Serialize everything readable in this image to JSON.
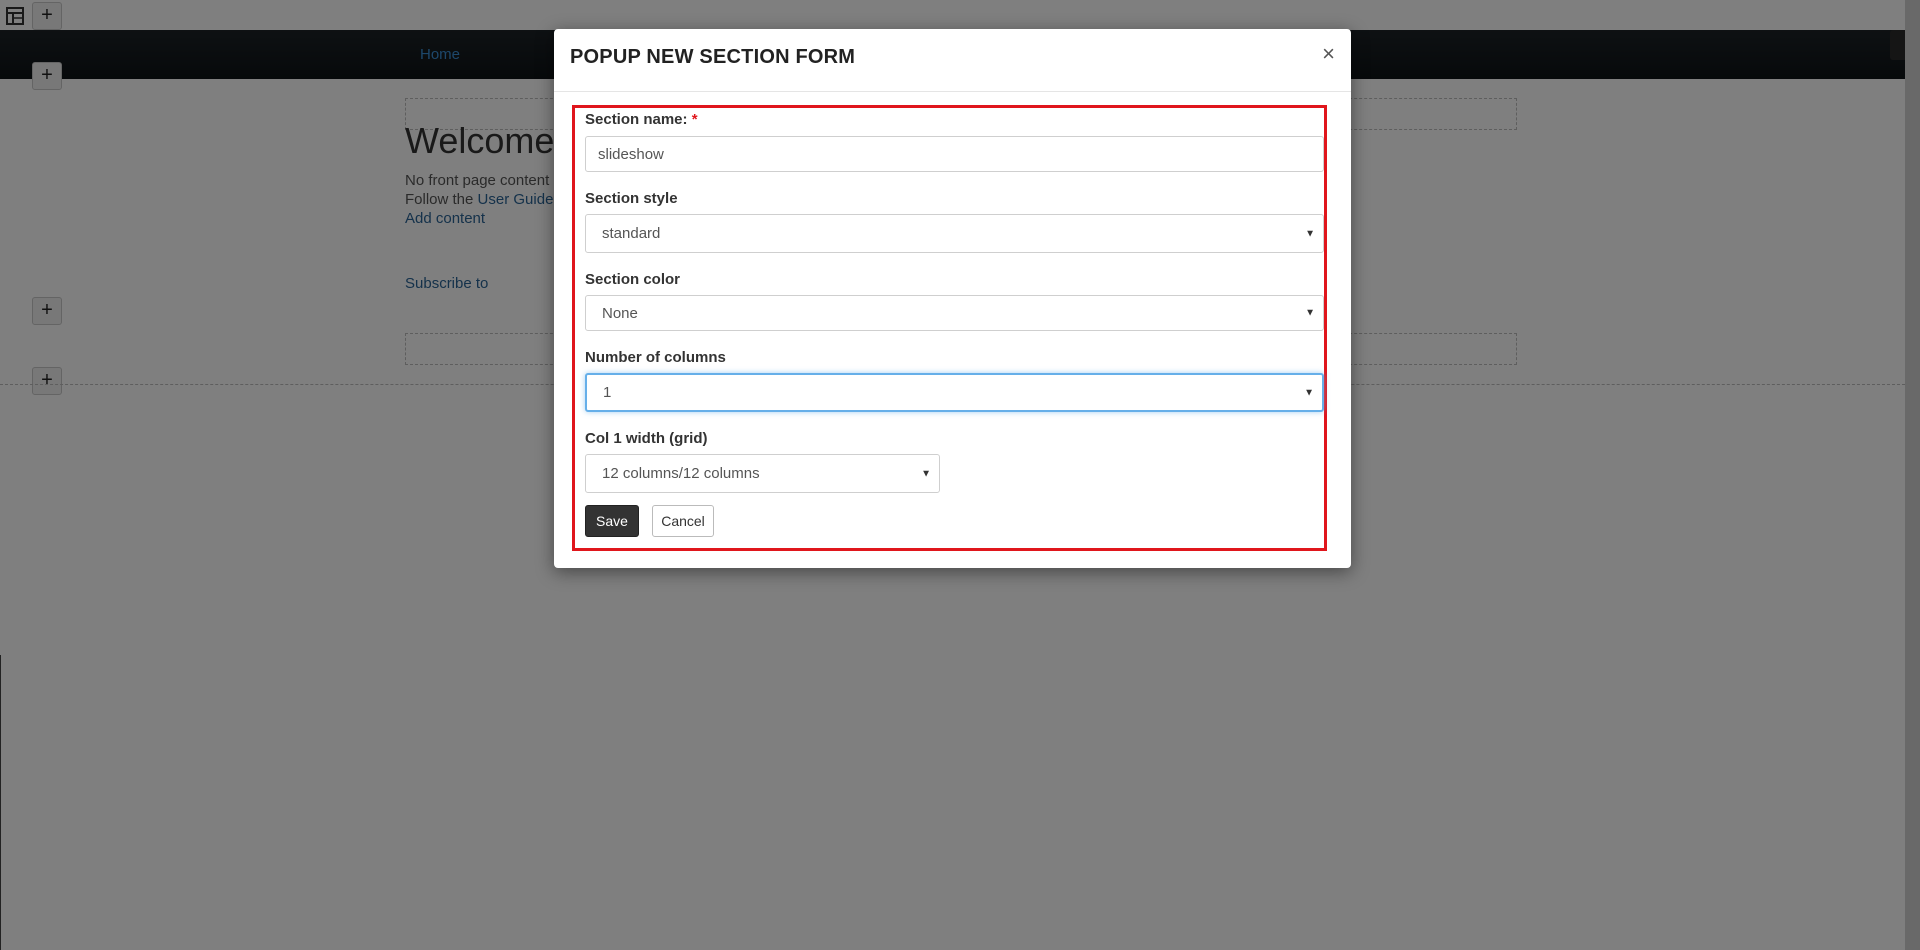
{
  "background": {
    "nav": {
      "home_label": "Home"
    },
    "page": {
      "welcome_title": "Welcome",
      "line1": "No front page content",
      "line2_prefix": "Follow the ",
      "line2_link": "User Guide",
      "add_content": "Add content",
      "subscribe": "Subscribe to"
    },
    "add_section_symbol": "+",
    "colors": {
      "navbar": "#111719",
      "overlay": "rgba(0,0,0,0.5)"
    }
  },
  "modal": {
    "title": "POPUP NEW SECTION FORM",
    "close_symbol": "×",
    "form": {
      "section_name": {
        "label": "Section name:",
        "required_mark": "*",
        "value": "slideshow"
      },
      "section_style": {
        "label": "Section style",
        "value": "standard"
      },
      "section_color": {
        "label": "Section color",
        "value": "None"
      },
      "num_columns": {
        "label": "Number of columns",
        "value": "1"
      },
      "col1_width": {
        "label": "Col 1 width (grid)",
        "value": "12 columns/12 columns"
      },
      "save_label": "Save",
      "cancel_label": "Cancel"
    },
    "colors": {
      "highlight_border": "#e0161c",
      "focus_border": "#66afe9",
      "save_bg": "#333333"
    }
  }
}
